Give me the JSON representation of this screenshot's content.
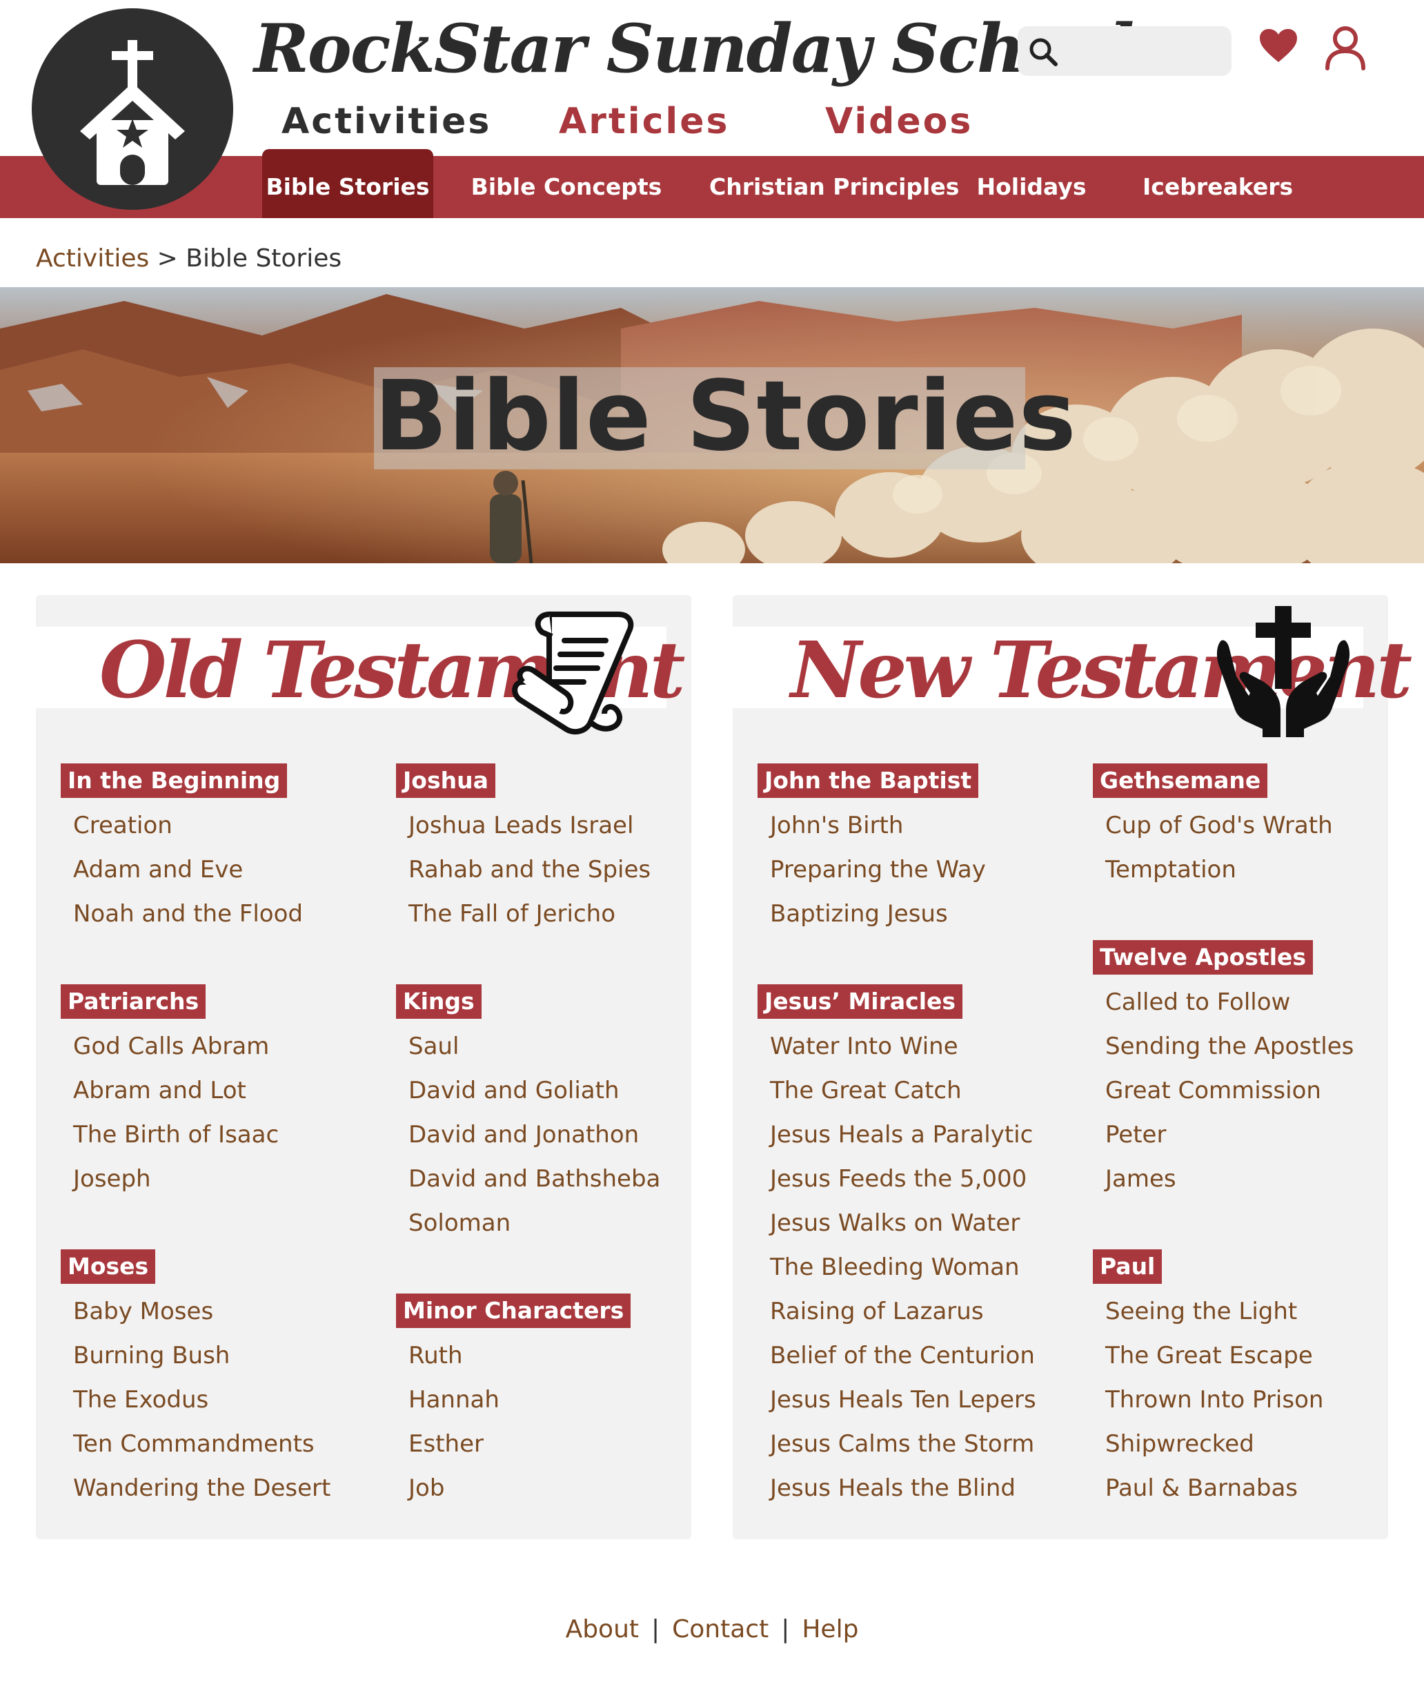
{
  "header": {
    "site_title": "RockStar Sunday School",
    "main_nav": {
      "activities": "Activities",
      "articles": "Articles",
      "videos": "Videos"
    },
    "search": {
      "placeholder": ""
    }
  },
  "categories": [
    "Bible Stories",
    "Bible Concepts",
    "Christian Principles",
    "Holidays",
    "Icebreakers"
  ],
  "breadcrumb": {
    "parent": "Activities",
    "separator": " > ",
    "current": "Bible Stories"
  },
  "hero": {
    "title": "Bible Stories"
  },
  "old_testament": {
    "title": "Old Testament",
    "groups": [
      {
        "name": "In the Beginning",
        "items": [
          "Creation",
          "Adam and Eve",
          "Noah and the Flood"
        ]
      },
      {
        "name": "Patriarchs",
        "items": [
          "God Calls Abram",
          "Abram and Lot",
          "The Birth of Isaac",
          "Joseph"
        ]
      },
      {
        "name": "Moses",
        "items": [
          "Baby Moses",
          "Burning Bush",
          "The Exodus",
          "Ten Commandments",
          "Wandering the Desert"
        ]
      },
      {
        "name": "Joshua",
        "items": [
          "Joshua Leads Israel",
          "Rahab and the Spies",
          "The Fall of Jericho"
        ]
      },
      {
        "name": "Kings",
        "items": [
          "Saul",
          "David and Goliath",
          "David and Jonathon",
          "David and Bathsheba",
          "Soloman"
        ]
      },
      {
        "name": "Minor Characters",
        "items": [
          "Ruth",
          "Hannah",
          "Esther",
          "Job"
        ]
      }
    ]
  },
  "new_testament": {
    "title": "New Testament",
    "groups": [
      {
        "name": "John the Baptist",
        "items": [
          "John's Birth",
          "Preparing the Way",
          "Baptizing Jesus"
        ]
      },
      {
        "name": "Jesus’ Miracles",
        "items": [
          "Water Into Wine",
          "The Great Catch",
          "Jesus Heals a Paralytic",
          "Jesus Feeds the 5,000",
          "Jesus Walks on Water",
          "The Bleeding Woman",
          "Raising of Lazarus",
          "Belief of the Centurion",
          "Jesus Heals Ten Lepers",
          "Jesus Calms the Storm",
          "Jesus Heals the Blind"
        ]
      },
      {
        "name": "Gethsemane",
        "items": [
          "Cup of God's Wrath",
          "Temptation"
        ]
      },
      {
        "name": "Twelve Apostles",
        "items": [
          "Called to Follow",
          "Sending the Apostles",
          "Great Commission",
          "Peter",
          "James"
        ]
      },
      {
        "name": "Paul",
        "items": [
          "Seeing the Light",
          "The Great Escape",
          "Thrown Into Prison",
          "Shipwrecked",
          "Paul & Barnabas"
        ]
      }
    ]
  },
  "footer": {
    "about": "About",
    "contact": "Contact",
    "help": "Help",
    "separator": "|"
  },
  "colors": {
    "brand_red": "#a8383d",
    "active_tab": "#7e1c1e",
    "dark": "#2f2f2f",
    "link_brown": "#7a4a22",
    "panel_bg": "#f2f2f2"
  },
  "icons": [
    "church-logo-icon",
    "search-icon",
    "heart-icon",
    "user-icon",
    "scroll-icon",
    "praying-hands-cross-icon"
  ]
}
